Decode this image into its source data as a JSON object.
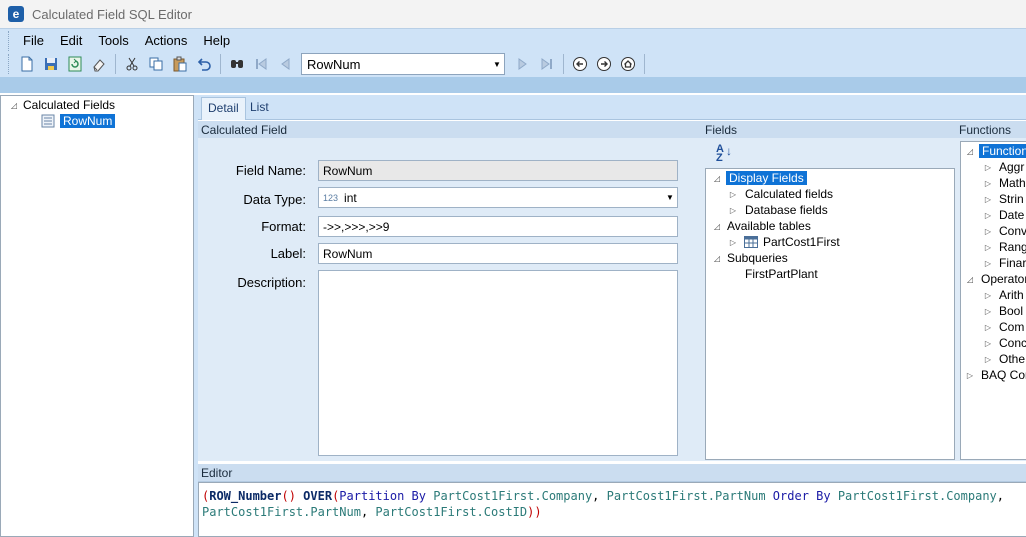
{
  "window": {
    "title": "Calculated Field SQL Editor",
    "logo_letter": "e"
  },
  "menu": [
    "File",
    "Edit",
    "Tools",
    "Actions",
    "Help"
  ],
  "toolbar": {
    "record_select_value": "RowNum",
    "icons": [
      "new-icon",
      "save-icon",
      "refresh-icon",
      "clear-icon",
      "cut-icon",
      "copy-icon",
      "paste-icon",
      "undo-icon",
      "search-icon",
      "first-record-icon",
      "previous-record-icon",
      "next-record-icon",
      "last-record-icon",
      "back-icon",
      "forward-icon",
      "home-icon"
    ]
  },
  "left_tree": {
    "root": "Calculated Fields",
    "child": "RowNum"
  },
  "tabs": [
    "Detail",
    "List"
  ],
  "calculated_field": {
    "header": "Calculated Field",
    "field_name_label": "Field Name:",
    "field_name_value": "RowNum",
    "data_type_label": "Data Type:",
    "data_type_badge": "123",
    "data_type_value": "int",
    "format_label": "Format:",
    "format_value": "->>,>>>,>>9",
    "label_label": "Label:",
    "label_value": "RowNum",
    "description_label": "Description:",
    "description_value": ""
  },
  "fields": {
    "header": "Fields",
    "sort_icon": "sort-az-icon",
    "sort_az_top": "A",
    "sort_az_bottom": "Z",
    "display_fields": "Display Fields",
    "calculated_fields": "Calculated fields",
    "database_fields": "Database fields",
    "available_tables": "Available tables",
    "table_name": "PartCost1First",
    "subqueries": "Subqueries",
    "subquery_name": "FirstPartPlant"
  },
  "functions": {
    "header": "Functions",
    "root": "Functions",
    "items": [
      "Aggr",
      "Math",
      "Strin",
      "Date",
      "Conv",
      "Rang",
      "Finar"
    ],
    "operators": "Operator",
    "operator_items": [
      "Arith",
      "Bool",
      "Com",
      "Conc",
      "Othe"
    ],
    "baq": "BAQ Cor"
  },
  "editor": {
    "header": "Editor",
    "sql_open_paren": "(",
    "sql_fn": "ROW_Number",
    "sql_call_parens": "()",
    "sql_over": " OVER",
    "sql_partition_paren": "(",
    "sql_partition": "Partition By",
    "sql_company": " PartCost1First.Company",
    "sql_comma1": ",",
    "sql_partnum": " PartCost1First.PartNum",
    "sql_order": " Order By",
    "sql_company2": " PartCost1First.Company",
    "sql_comma2": ",",
    "sql_partnum2": "PartCost1First.PartNum",
    "sql_comma3": ",",
    "sql_costid": " PartCost1First.CostID",
    "sql_close": "))"
  },
  "colors": {
    "accent": "#0f73d6",
    "band": "#cfe3f7",
    "panel": "#dfebf7"
  }
}
